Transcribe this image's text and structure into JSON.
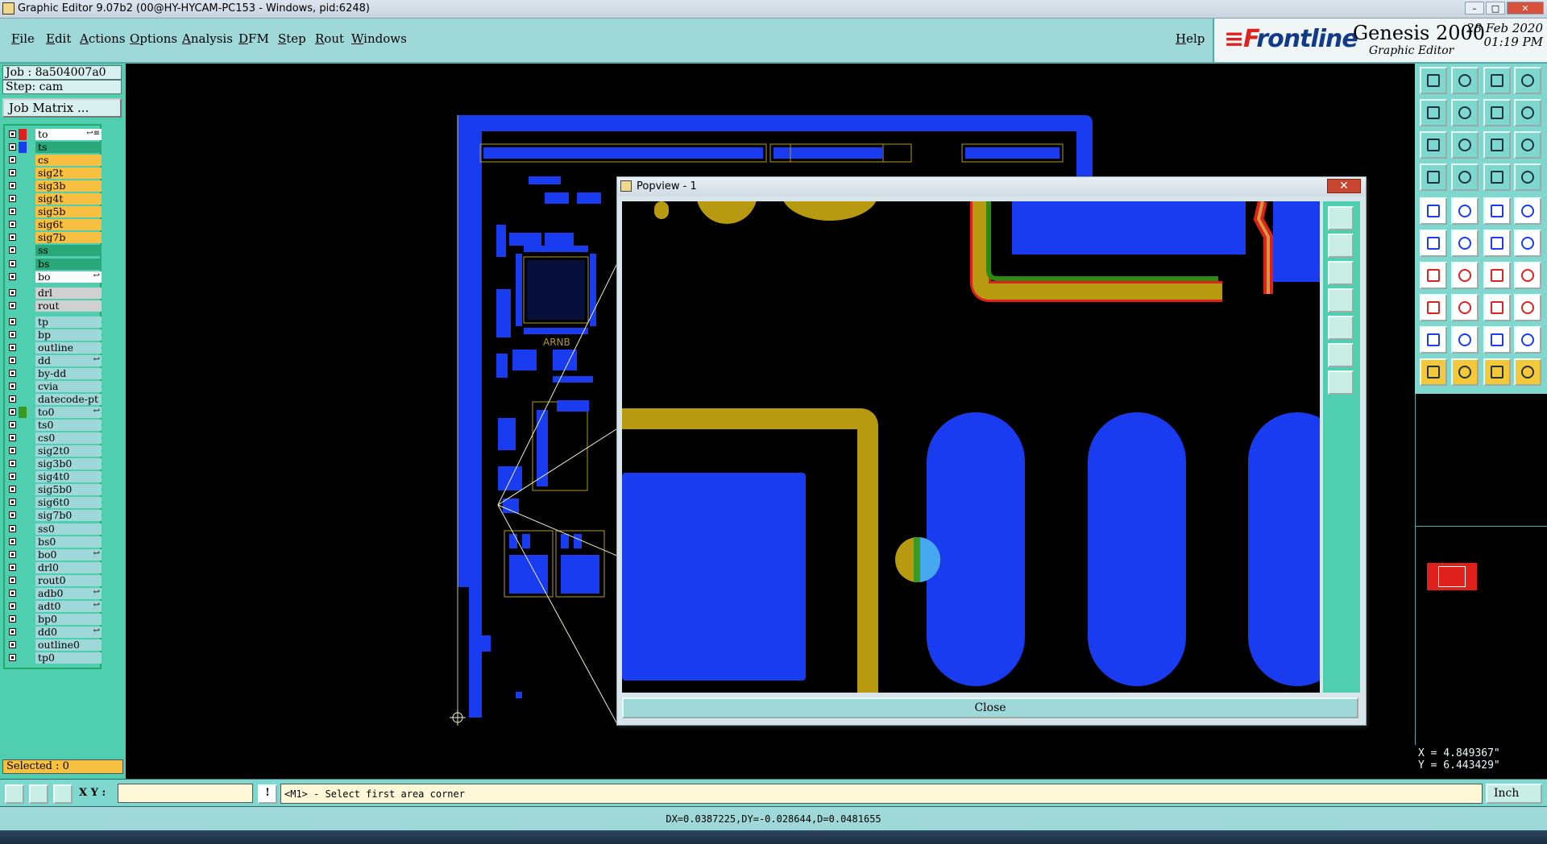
{
  "window": {
    "title": "Graphic Editor 9.07b2 (00@HY-HYCAM-PC153 - Windows, pid:6248)",
    "min_label": "–",
    "max_label": "□",
    "close_label": "✕"
  },
  "menu": {
    "items": [
      "File",
      "Edit",
      "Actions",
      "Options",
      "Analysis",
      "DFM",
      "Step",
      "Rout",
      "Windows"
    ],
    "help": "Help"
  },
  "brand": {
    "logo_mark": "≡F",
    "logo": "rontline",
    "product": "Genesis 2000",
    "subtitle": "Graphic Editor",
    "date": "28 Feb 2020",
    "time": "01:19 PM"
  },
  "job": {
    "job_line": "Job : 8a504007a0",
    "step_line": "Step: cam",
    "matrix_button": "Job Matrix ..."
  },
  "layers": [
    {
      "name": "to",
      "color": "#e02020",
      "bg": "#ffffff",
      "mark": "↩≡",
      "sel": true
    },
    {
      "name": "ts",
      "color": "#1a3cf0",
      "bg": "#2aa87a",
      "mark": ""
    },
    {
      "name": "cs",
      "color": "",
      "bg": "#f8c040",
      "mark": ""
    },
    {
      "name": "sig2t",
      "color": "",
      "bg": "#f8c040",
      "mark": ""
    },
    {
      "name": "sig3b",
      "color": "",
      "bg": "#f8c040",
      "mark": ""
    },
    {
      "name": "sig4t",
      "color": "",
      "bg": "#f8c040",
      "mark": ""
    },
    {
      "name": "sig5b",
      "color": "",
      "bg": "#f8c040",
      "mark": ""
    },
    {
      "name": "sig6t",
      "color": "",
      "bg": "#f8c040",
      "mark": ""
    },
    {
      "name": "sig7b",
      "color": "",
      "bg": "#f8c040",
      "mark": ""
    },
    {
      "name": "ss",
      "color": "",
      "bg": "#2aa87a",
      "mark": ""
    },
    {
      "name": "bs",
      "color": "",
      "bg": "#2aa87a",
      "mark": ""
    },
    {
      "name": "bo",
      "color": "",
      "bg": "#ffffff",
      "mark": "↩"
    },
    {
      "name": "drl",
      "color": "",
      "bg": "#d0d0d0",
      "mark": ""
    },
    {
      "name": "rout",
      "color": "",
      "bg": "#d0d0d0",
      "mark": ""
    },
    {
      "name": "tp",
      "color": "",
      "bg": "#9fd8d8",
      "mark": ""
    },
    {
      "name": "bp",
      "color": "",
      "bg": "#9fd8d8",
      "mark": ""
    },
    {
      "name": "outline",
      "color": "",
      "bg": "#9fd8d8",
      "mark": ""
    },
    {
      "name": "dd",
      "color": "",
      "bg": "#9fd8d8",
      "mark": "↩"
    },
    {
      "name": "by-dd",
      "color": "",
      "bg": "#9fd8d8",
      "mark": ""
    },
    {
      "name": "cvia",
      "color": "",
      "bg": "#9fd8d8",
      "mark": ""
    },
    {
      "name": "datecode-pt",
      "color": "",
      "bg": "#9fd8d8",
      "mark": ""
    },
    {
      "name": "to0",
      "color": "#3a9a20",
      "bg": "#9fd8d8",
      "mark": "↩"
    },
    {
      "name": "ts0",
      "color": "",
      "bg": "#9fd8d8",
      "mark": ""
    },
    {
      "name": "cs0",
      "color": "",
      "bg": "#9fd8d8",
      "mark": ""
    },
    {
      "name": "sig2t0",
      "color": "",
      "bg": "#9fd8d8",
      "mark": ""
    },
    {
      "name": "sig3b0",
      "color": "",
      "bg": "#9fd8d8",
      "mark": ""
    },
    {
      "name": "sig4t0",
      "color": "",
      "bg": "#9fd8d8",
      "mark": ""
    },
    {
      "name": "sig5b0",
      "color": "",
      "bg": "#9fd8d8",
      "mark": ""
    },
    {
      "name": "sig6t0",
      "color": "",
      "bg": "#9fd8d8",
      "mark": ""
    },
    {
      "name": "sig7b0",
      "color": "",
      "bg": "#9fd8d8",
      "mark": ""
    },
    {
      "name": "ss0",
      "color": "",
      "bg": "#9fd8d8",
      "mark": ""
    },
    {
      "name": "bs0",
      "color": "",
      "bg": "#9fd8d8",
      "mark": ""
    },
    {
      "name": "bo0",
      "color": "",
      "bg": "#9fd8d8",
      "mark": "↩"
    },
    {
      "name": "drl0",
      "color": "",
      "bg": "#9fd8d8",
      "mark": ""
    },
    {
      "name": "rout0",
      "color": "",
      "bg": "#9fd8d8",
      "mark": ""
    },
    {
      "name": "adb0",
      "color": "",
      "bg": "#9fd8d8",
      "mark": "↩"
    },
    {
      "name": "adt0",
      "color": "",
      "bg": "#9fd8d8",
      "mark": "↩"
    },
    {
      "name": "bp0",
      "color": "",
      "bg": "#9fd8d8",
      "mark": ""
    },
    {
      "name": "dd0",
      "color": "",
      "bg": "#9fd8d8",
      "mark": "↩"
    },
    {
      "name": "outline0",
      "color": "",
      "bg": "#9fd8d8",
      "mark": ""
    },
    {
      "name": "tp0",
      "color": "",
      "bg": "#9fd8d8",
      "mark": ""
    }
  ],
  "selected": "Selected : 0",
  "popview": {
    "title": "Popview - 1",
    "close_x": "✕",
    "close_button": "Close"
  },
  "pcb_labels": [
    "ARNB"
  ],
  "coords": {
    "x": "X = 4.849367\"",
    "y": "Y = 6.443429\""
  },
  "cmd": {
    "xy_label": "X Y :",
    "xy_value": "",
    "prompt": "<M1> - Select first area corner",
    "units": "Inch"
  },
  "status": "DX=0.0387225,DY=-0.028644,D=0.0481655",
  "icons": {
    "right_toolbar": [
      "open-window-icon",
      "save-icon",
      "home-icon",
      "grid-icon",
      "layer-in-icon",
      "layer-out-icon",
      "step-left-icon",
      "step-right-icon",
      "zoom-fit-icon",
      "zoom-in-icon",
      "scale-one-icon",
      "help-icon",
      "snap-icon",
      "grid-toggle-icon",
      "measure-icon",
      "dfm-icon",
      "camera-icon",
      "pen-icon",
      "ruler-icon",
      "pad-icon",
      "connect-icon",
      "cross-icon",
      "move-icon",
      "copy-icon",
      "line-icon",
      "slash-icon",
      "rotate-icon",
      "mirror-icon",
      "delete-icon",
      "minus-icon",
      "split-icon",
      "arc-icon",
      "triangle-icon",
      "a-shape-icon",
      "arch-icon",
      "trapezoid-icon",
      "select-icon",
      "cursor-icon",
      "pointer-icon",
      "cursor-multi-icon"
    ]
  }
}
